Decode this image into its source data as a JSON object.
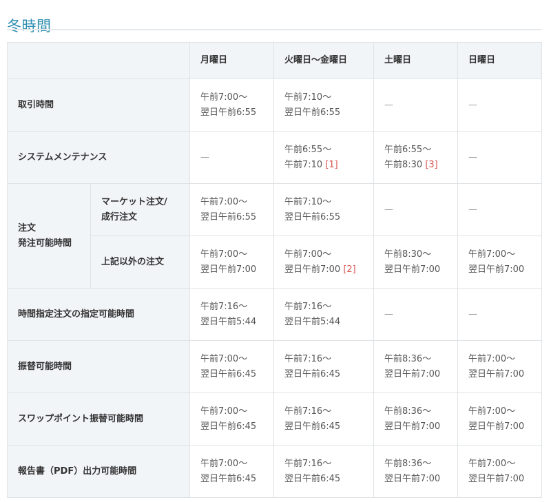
{
  "title": "冬時間",
  "headers": [
    "",
    "月曜日",
    "火曜日〜金曜日",
    "土曜日",
    "日曜日"
  ],
  "rows": {
    "trading": {
      "label": "取引時間",
      "mon": [
        "午前7:00〜",
        "翌日午前6:55"
      ],
      "tuefri": [
        "午前7:10〜",
        "翌日午前6:55"
      ],
      "sat": "—",
      "sun": "—"
    },
    "maintenance": {
      "label": "システムメンテナンス",
      "mon": "—",
      "tuefri": [
        "午前6:55〜",
        "午前7:10",
        "[1]"
      ],
      "sat": [
        "午前6:55〜",
        "午前8:30",
        "[3]"
      ],
      "sun": "—"
    },
    "order": {
      "label_line1": "注文",
      "label_line2": "発注可能時間",
      "market": {
        "label_line1": "マーケット注文/",
        "label_line2": "成行注文",
        "mon": [
          "午前7:00〜",
          "翌日午前6:55"
        ],
        "tuefri": [
          "午前7:10〜",
          "翌日午前6:55"
        ],
        "sat": "—",
        "sun": "—"
      },
      "other": {
        "label": "上記以外の注文",
        "mon": [
          "午前7:00〜",
          "翌日午前7:00"
        ],
        "tuefri": [
          "午前7:00〜",
          "翌日午前7:00",
          "[2]"
        ],
        "sat": [
          "午前8:30〜",
          "翌日午前7:00"
        ],
        "sun": [
          "午前7:00〜",
          "翌日午前7:00"
        ]
      }
    },
    "timed_order": {
      "label": "時間指定注文の指定可能時間",
      "mon": [
        "午前7:16〜",
        "翌日午前5:44"
      ],
      "tuefri": [
        "午前7:16〜",
        "翌日午前5:44"
      ],
      "sat": "—",
      "sun": "—"
    },
    "transfer": {
      "label": "振替可能時間",
      "mon": [
        "午前7:00〜",
        "翌日午前6:45"
      ],
      "tuefri": [
        "午前7:16〜",
        "翌日午前6:45"
      ],
      "sat": [
        "午前8:36〜",
        "翌日午前7:00"
      ],
      "sun": [
        "午前7:00〜",
        "翌日午前7:00"
      ]
    },
    "swap": {
      "label": "スワップポイント振替可能時間",
      "mon": [
        "午前7:00〜",
        "翌日午前6:45"
      ],
      "tuefri": [
        "午前7:16〜",
        "翌日午前6:45"
      ],
      "sat": [
        "午前8:36〜",
        "翌日午前7:00"
      ],
      "sun": [
        "午前7:00〜",
        "翌日午前7:00"
      ]
    },
    "report": {
      "label": "報告書（PDF）出力可能時間",
      "mon": [
        "午前7:00〜",
        "翌日午前6:45"
      ],
      "tuefri": [
        "午前7:16〜",
        "翌日午前6:45"
      ],
      "sat": [
        "午前8:36〜",
        "翌日午前7:00"
      ],
      "sun": [
        "午前7:00〜",
        "翌日午前7:00"
      ]
    }
  }
}
